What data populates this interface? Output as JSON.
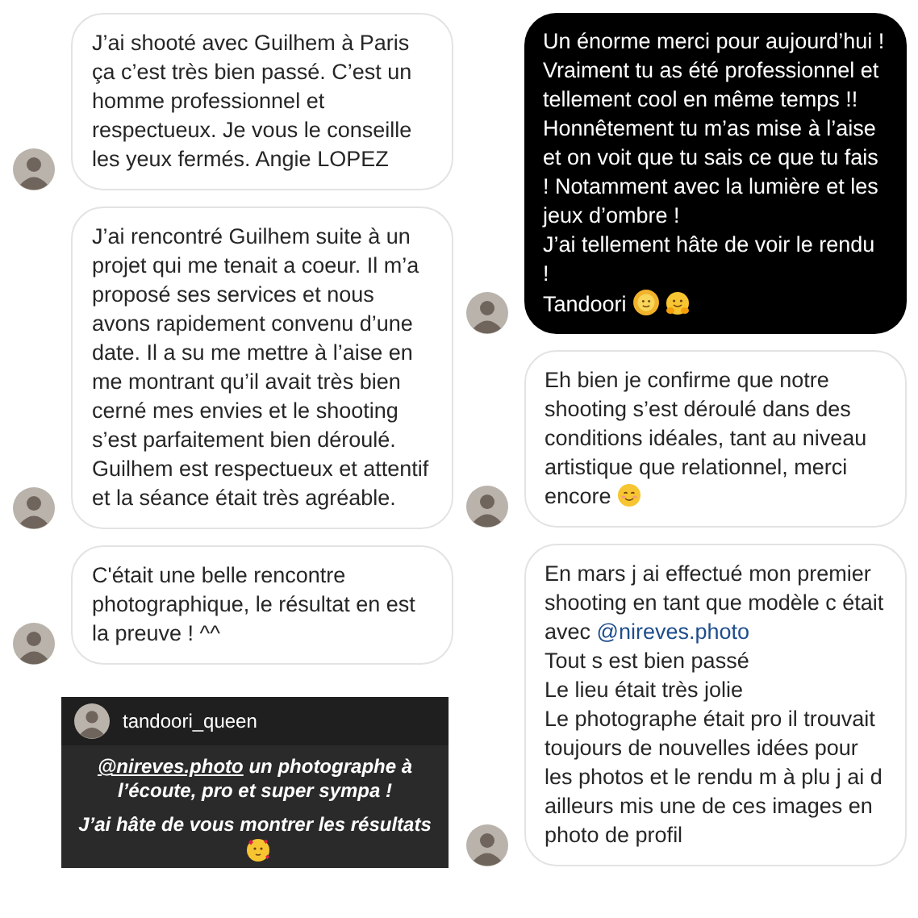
{
  "columns": [
    {
      "items": [
        {
          "kind": "bubble",
          "paragraphs": [
            {
              "text": "J’ai shooté avec Guilhem à Paris ça c’est très bien passé. C’est un homme professionnel et respectueux. Je vous le conseille les yeux fermés. Angie LOPEZ"
            }
          ]
        },
        {
          "kind": "bubble",
          "paragraphs": [
            {
              "text": "J’ai rencontré Guilhem suite à un projet qui me tenait a coeur. Il m’a proposé ses services et nous avons rapidement convenu d’une date. Il a su me mettre à l’aise en me montrant qu’il avait très bien cerné mes envies et le shooting s’est parfaitement bien déroulé. Guilhem est respectueux et attentif et la séance était très agréable."
            }
          ]
        },
        {
          "kind": "bubble",
          "paragraphs": [
            {
              "text": "C'était une belle rencontre photographique, le résultat en est la preuve ! ^^"
            }
          ]
        },
        {
          "kind": "story",
          "username": "tandoori_queen",
          "paragraphs": [
            {
              "link": "@nireves.photo",
              "text": "un photographe à l’écoute, pro et super sympa !"
            },
            {
              "text": "J’ai hâte de vous montrer les résultats",
              "emoji": [
                {
                  "kind": "hearts"
                }
              ]
            }
          ]
        }
      ]
    },
    {
      "items": [
        {
          "kind": "dark_bubble",
          "paragraphs": [
            {
              "text": "Un énorme merci pour aujourd’hui !"
            },
            {
              "text": "Vraiment tu as été professionnel et tellement cool en même temps !! Honnêtement tu m’as mise à l’aise et on voit que tu sais ce que tu fais ! Notamment avec la lumière et les jeux d’ombre !"
            },
            {
              "text": "J’ai tellement hâte de voir le rendu !"
            },
            {
              "text": "Tandoori",
              "emoji": [
                {
                  "kind": "sun"
                },
                {
                  "kind": "hug"
                }
              ]
            }
          ]
        },
        {
          "kind": "bubble",
          "paragraphs": [
            {
              "text": "Eh bien je confirme que notre shooting s’est déroulé dans des conditions idéales, tant au niveau artistique que relationnel, merci encore",
              "emoji": [
                {
                  "kind": "smile"
                }
              ]
            }
          ]
        },
        {
          "kind": "bubble",
          "paragraphs": [
            {
              "text": "En mars j ai effectué mon premier shooting en tant que modèle c était avec",
              "link": "@nireves.photo"
            },
            {
              "text": "Tout s est bien passé"
            },
            {
              "text": "Le lieu était très jolie"
            },
            {
              "text": "Le photographe était pro il trouvait toujours de nouvelles idées pour les photos et le rendu m à plu j ai d ailleurs mis une de ces images  en photo de profil"
            }
          ]
        }
      ]
    }
  ]
}
